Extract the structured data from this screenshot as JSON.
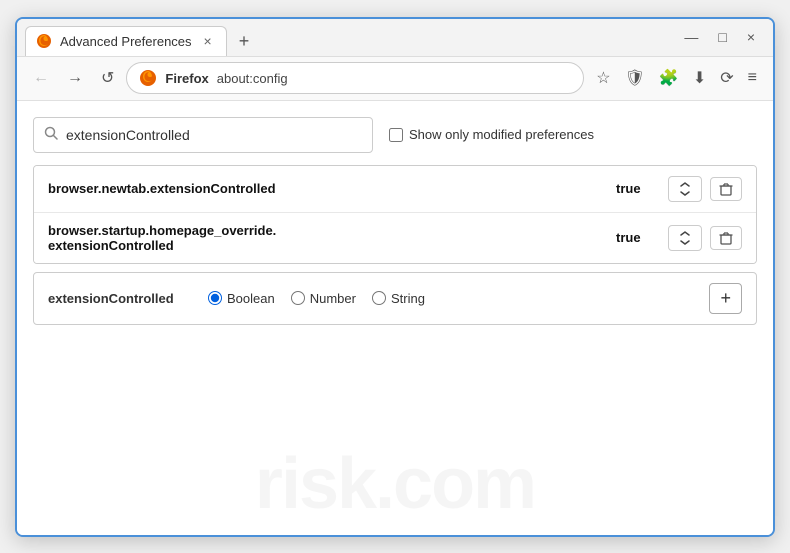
{
  "window": {
    "title": "Advanced Preferences",
    "close_label": "×",
    "minimize_label": "—",
    "maximize_label": "□",
    "new_tab_label": "+"
  },
  "nav": {
    "back_label": "←",
    "forward_label": "→",
    "reload_label": "↺",
    "browser_name": "Firefox",
    "address": "about:config",
    "bookmark_icon": "☆",
    "shield_icon": "🛡",
    "extension_icon": "🧩",
    "download_icon": "⬇",
    "sync_icon": "⟳",
    "menu_icon": "≡"
  },
  "search": {
    "placeholder": "extensionControlled",
    "value": "extensionControlled",
    "modified_label": "Show only modified preferences"
  },
  "preferences": [
    {
      "name": "browser.newtab.extensionControlled",
      "value": "true"
    },
    {
      "name": "browser.startup.homepage_override.\nextensionControlled",
      "name_line1": "browser.startup.homepage_override.",
      "name_line2": "extensionControlled",
      "value": "true"
    }
  ],
  "add_row": {
    "name": "extensionControlled",
    "type_options": [
      {
        "id": "boolean",
        "label": "Boolean",
        "checked": true
      },
      {
        "id": "number",
        "label": "Number",
        "checked": false
      },
      {
        "id": "string",
        "label": "String",
        "checked": false
      }
    ],
    "add_button_label": "+"
  },
  "watermark": "risk.com"
}
